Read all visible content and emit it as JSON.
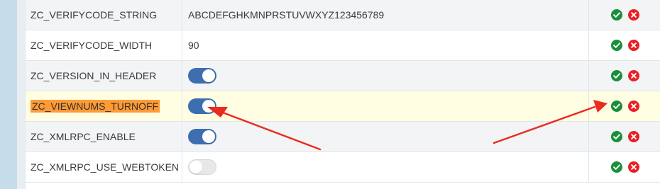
{
  "rows": [
    {
      "name": "ZC_VERIFYCODE_STRING",
      "value": "ABCDEFGHKMNPRSTUVWXYZ123456789",
      "type": "text",
      "highlighted": false
    },
    {
      "name": "ZC_VERIFYCODE_WIDTH",
      "value": "90",
      "type": "text",
      "highlighted": false
    },
    {
      "name": "ZC_VERSION_IN_HEADER",
      "type": "toggle",
      "toggle_state": "on",
      "highlighted": false
    },
    {
      "name": "ZC_VIEWNUMS_TURNOFF",
      "type": "toggle",
      "toggle_state": "on",
      "highlighted": true
    },
    {
      "name": "ZC_XMLRPC_ENABLE",
      "type": "toggle",
      "toggle_state": "on",
      "highlighted": false
    },
    {
      "name": "ZC_XMLRPC_USE_WEBTOKEN",
      "type": "toggle",
      "toggle_state": "off",
      "highlighted": false
    }
  ],
  "icons": {
    "save": "check-circle-icon",
    "delete": "close-circle-icon"
  },
  "colors": {
    "save_icon": "#198f3a",
    "delete_icon": "#eb1e23",
    "toggle_on": "#3d6fb0",
    "toggle_off": "#e8e8e8",
    "highlighted_row": "#fffde2",
    "highlighted_name": "#ff9a35",
    "annotation_arrow": "#ec2b1f"
  }
}
